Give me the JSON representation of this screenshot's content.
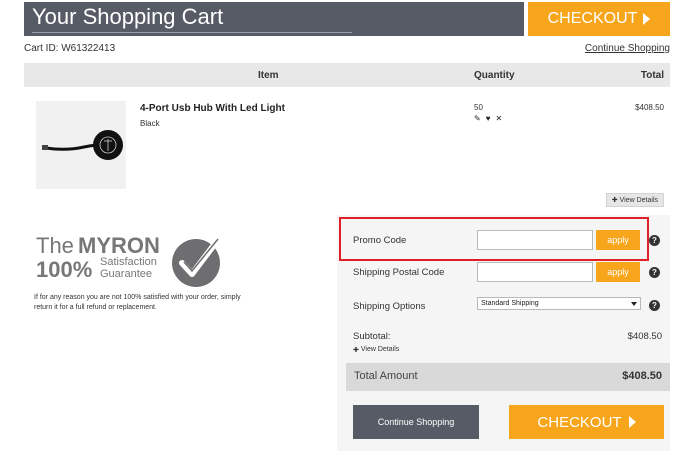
{
  "header": {
    "title": "Your Shopping Cart",
    "checkout_label": "CHECKOUT",
    "cart_id": "Cart ID: W61322413",
    "continue_link": "Continue Shopping"
  },
  "table": {
    "columns": [
      "Item",
      "Quantity",
      "Total"
    ],
    "items": [
      {
        "name": "4-Port Usb Hub With Led Light",
        "variant": "Black",
        "quantity": "50",
        "total": "$408.50",
        "view_details": "View Details",
        "actions": [
          "edit-icon",
          "heart-icon",
          "close-icon"
        ]
      }
    ]
  },
  "guarantee": {
    "logo_text_the": "The",
    "logo_text_brand": "MYRON",
    "logo_text_percent": "100%",
    "logo_text_sat": "Satisfaction",
    "logo_text_guar": "Guarantee",
    "description": "If for any reason you are not 100% satisfied with your order, simply return it for a full refund or replacement."
  },
  "form": {
    "promo_label": "Promo Code",
    "promo_value": "",
    "postal_label": "Shipping Postal Code",
    "postal_value": "",
    "apply_label": "apply",
    "shipping_label": "Shipping Options",
    "shipping_selected": "Standard Shipping",
    "help_glyph": "?"
  },
  "summary": {
    "subtotal_label": "Subtotal:",
    "subtotal_value": "$408.50",
    "view_details": "View Details",
    "total_label": "Total Amount",
    "total_value": "$408.50",
    "continue_label": "Continue Shopping",
    "checkout_label": "CHECKOUT"
  },
  "colors": {
    "accent": "#f7a51a",
    "header_bg": "#565b66",
    "highlight": "#e02027"
  }
}
